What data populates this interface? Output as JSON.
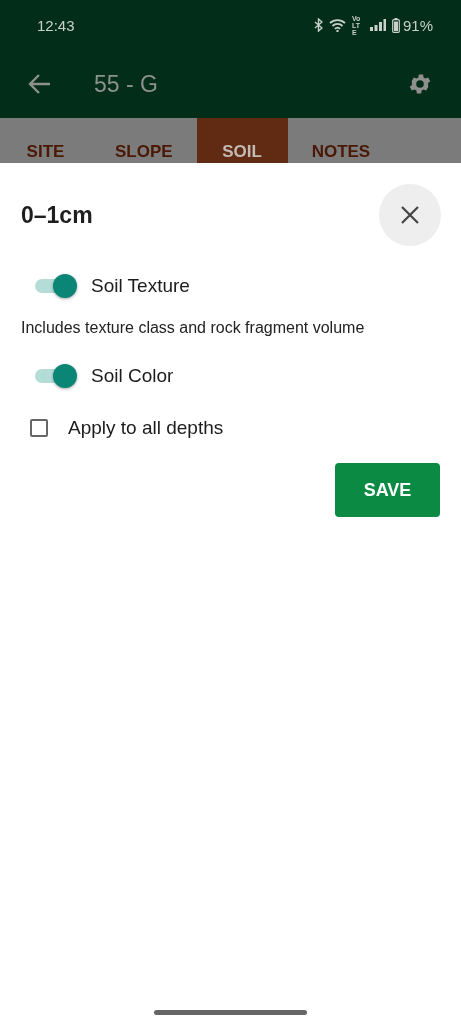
{
  "status_bar": {
    "time": "12:43",
    "network": "Vo LTE",
    "battery": "91%"
  },
  "app_bar": {
    "title": "55 - G"
  },
  "tabs": [
    {
      "label": "SITE",
      "selected": false
    },
    {
      "label": "SLOPE",
      "selected": false
    },
    {
      "label": "SOIL",
      "selected": true
    },
    {
      "label": "NOTES",
      "selected": false
    }
  ],
  "sheet": {
    "title": "0–1cm",
    "options": [
      {
        "kind": "switch",
        "label": "Soil Texture",
        "on": true,
        "description": "Includes texture class and rock fragment volume"
      },
      {
        "kind": "switch",
        "label": "Soil Color",
        "on": true
      },
      {
        "kind": "checkbox",
        "label": "Apply to all depths",
        "checked": false
      }
    ],
    "save_button": "SAVE"
  }
}
